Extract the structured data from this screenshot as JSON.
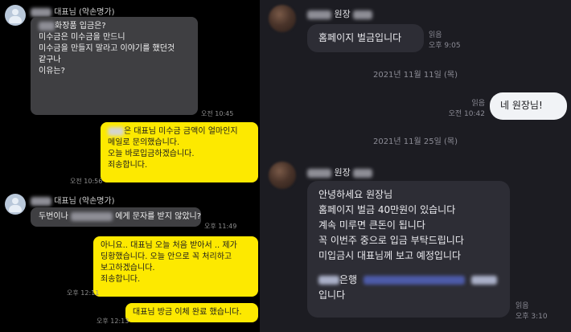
{
  "left": {
    "msg1": {
      "sender": "대표님 (약손명가)",
      "line1": "화장품 입금은?",
      "line2": "미수금은 미수금을 만드니",
      "line3": "미수금을 만들지 말라고 이야기를 했던것",
      "line4": "같구나",
      "line5": "이유는?",
      "time": "오전 10:45"
    },
    "reply1": {
      "line1": "은 대표님 미수금 금액이 얼마인지",
      "line2": "메일로 문의했습니다.",
      "line3": "오늘 바로입금하겠습니다.",
      "line4": "죄송합니다.",
      "time": "오전 10:56"
    },
    "msg2": {
      "sender": "대표님 (약손명가)",
      "text_a": "두번이나",
      "text_b": "에게 문자를 받지 않았니?",
      "time": "오후 11:49"
    },
    "reply2": {
      "line1": "아니요.. 대표님 오늘 처음 받아서 .. 제가",
      "line2": "딩황했습니다. 오늘 안으로 꼭 처리하고",
      "line3": "보고하겠습니다.",
      "line4": "죄송합니다.",
      "time": "오후 12:11"
    },
    "reply3": {
      "text": "대표님 방금 이체 완료 했습니다.",
      "time": "오후 12:13"
    }
  },
  "right": {
    "msg1": {
      "sender": "원장",
      "text": "홈페이지 벌금입니다",
      "read": "읽음",
      "time": "오후 9:05"
    },
    "date1": "2021년 11월 11일 (목)",
    "mine": {
      "text": "네 원장님!",
      "read": "읽음",
      "time": "오전 10:42"
    },
    "date2": "2021년 11월 25일 (목)",
    "msg2": {
      "sender": "원장",
      "line1": "안녕하세요 원장님",
      "line2": "홈페이지 벌금 40만원이 있습니다",
      "line3": "계속 미루면 큰돈이 됩니다",
      "line4": "꼭 이번주 중으로 입금 부탁드립니다",
      "line5": "미입금시 대표님께 보고 예정입니다",
      "bank": "은행",
      "line7": "입니다",
      "read": "읽음",
      "time": "오후 3:10"
    }
  }
}
